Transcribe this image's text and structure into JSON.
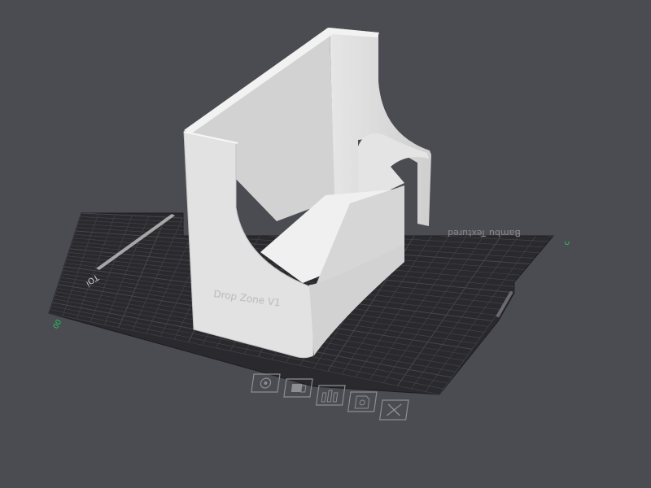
{
  "viewport": {
    "background_color": "#4b4b52",
    "plate_color": "#2a2a2e",
    "grid_color": "#46464b",
    "model_color": "#d8d8d8"
  },
  "plate": {
    "label": "Bambu Textured",
    "side_label": "ᴉOꓕ",
    "origin_label": "00",
    "axis_label": "ɔ"
  },
  "model": {
    "embossed_text": "Drop Zone V1"
  },
  "plate_toolbar": {
    "icons": [
      "target-icon",
      "orient-icon",
      "arrange-icon",
      "lock-icon",
      "close-icon"
    ]
  }
}
